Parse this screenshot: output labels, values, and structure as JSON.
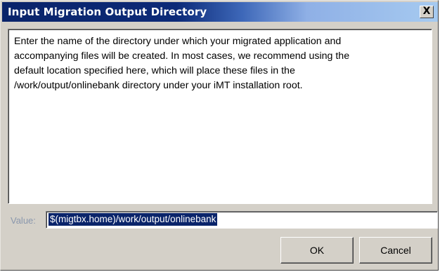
{
  "dialog": {
    "title": "Input Migration Output Directory",
    "close_label": "X"
  },
  "message": {
    "lines": [
      "Enter the name of the directory under which your migrated application and",
      "accompanying files will be created.  In most cases, we recommend using the",
      "default location specified here, which will place these files in the",
      "/work/output/onlinebank directory under your iMT installation root."
    ]
  },
  "value_field": {
    "label": "Value:",
    "value": "$(migtbx.home)/work/output/onlinebank"
  },
  "buttons": {
    "ok_label": "OK",
    "cancel_label": "Cancel"
  }
}
